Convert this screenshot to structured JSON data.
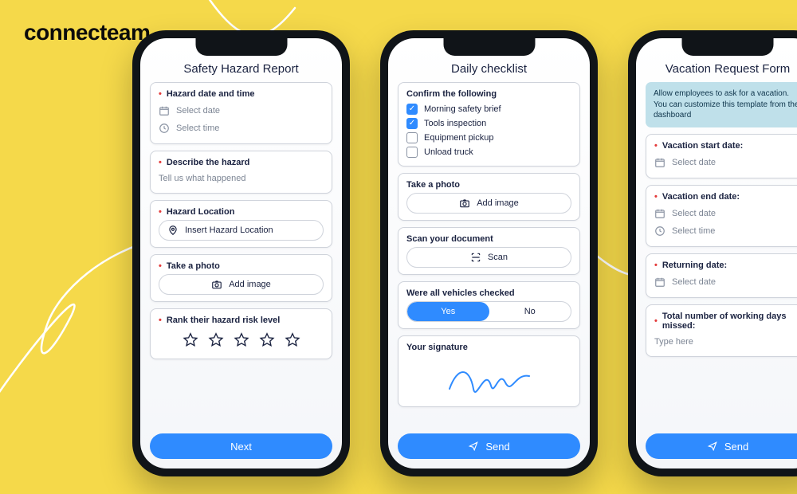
{
  "logo": "connecteam",
  "icons": {
    "calendar": "calendar-icon",
    "clock": "clock-icon",
    "pin": "pin-icon",
    "camera": "camera-icon",
    "scan": "scan-icon",
    "send": "send-icon",
    "star": "star-outline-icon"
  },
  "phone1": {
    "title": "Safety Hazard Report",
    "s1": {
      "label": "Hazard date and time",
      "date_ph": "Select date",
      "time_ph": "Select time"
    },
    "s2": {
      "label": "Describe the hazard",
      "ph": "Tell us what happened"
    },
    "s3": {
      "label": "Hazard Location",
      "ph": "Insert Hazard Location"
    },
    "s4": {
      "label": "Take a photo",
      "btn": "Add image"
    },
    "s5": {
      "label": "Rank their hazard risk level"
    },
    "cta": "Next"
  },
  "phone2": {
    "title": "Daily checklist",
    "confirm": {
      "label": "Confirm the following",
      "items": [
        {
          "text": "Morning safety brief",
          "checked": true
        },
        {
          "text": "Tools inspection",
          "checked": true
        },
        {
          "text": "Equipment pickup",
          "checked": false
        },
        {
          "text": "Unload truck",
          "checked": false
        }
      ]
    },
    "photo": {
      "label": "Take a photo",
      "btn": "Add image"
    },
    "scan": {
      "label": "Scan your document",
      "btn": "Scan"
    },
    "vehicles": {
      "label": "Were all vehicles checked",
      "yes": "Yes",
      "no": "No",
      "selected": "yes"
    },
    "sign": {
      "label": "Your signature"
    },
    "cta": "Send"
  },
  "phone3": {
    "title": "Vacation Request Form",
    "note": "Allow employees to ask for a vacation. You can customize this template from the dashboard",
    "start": {
      "label": "Vacation start date:",
      "ph": "Select date"
    },
    "end": {
      "label": "Vacation end date:",
      "date_ph": "Select date",
      "time_ph": "Select time"
    },
    "ret": {
      "label": "Returning date:",
      "ph": "Select date"
    },
    "days": {
      "label": "Total number of working days missed:",
      "ph": "Type here"
    },
    "cta": "Send"
  }
}
